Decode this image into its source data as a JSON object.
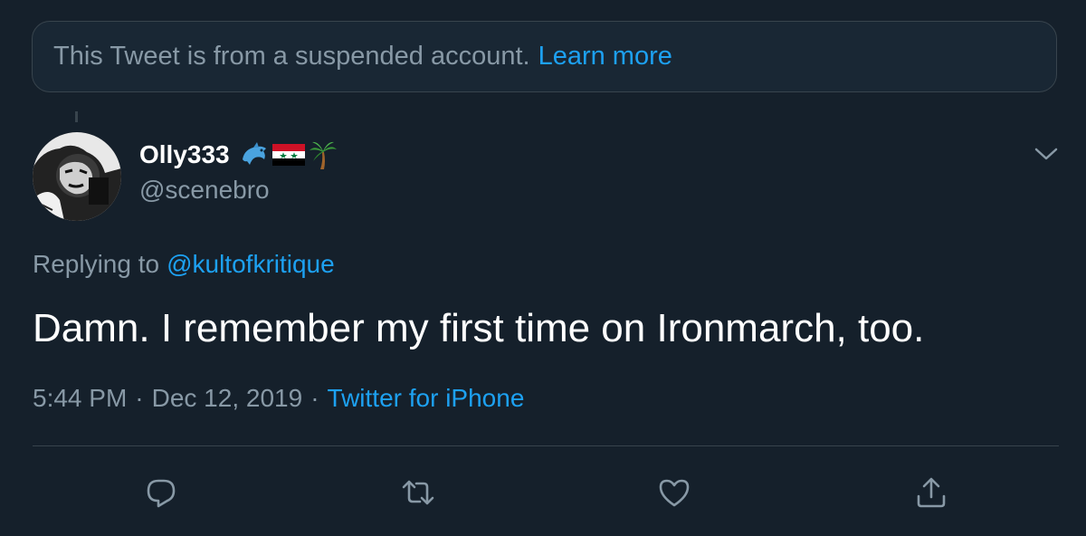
{
  "notice": {
    "text": "This Tweet is from a suspended account.",
    "link_text": "Learn more"
  },
  "author": {
    "display_name": "Olly333",
    "handle": "@scenebro",
    "name_emojis": [
      "dolphin-emoji",
      "syria-flag-emoji",
      "palm-tree-emoji"
    ]
  },
  "reply": {
    "prefix": "Replying to",
    "mention": "@kultofkritique"
  },
  "tweet": {
    "text": "Damn. I remember my first time on Ironmarch, too."
  },
  "meta": {
    "time": "5:44 PM",
    "separator": "·",
    "date": "Dec 12, 2019",
    "source": "Twitter for iPhone"
  },
  "actions": [
    "reply-icon",
    "retweet-icon",
    "like-icon",
    "share-icon"
  ],
  "colors": {
    "background": "#15202b",
    "notice_background": "#192734",
    "border": "#38444d",
    "secondary_text": "#8899a6",
    "accent": "#1da1f2",
    "primary_text": "#ffffff"
  }
}
